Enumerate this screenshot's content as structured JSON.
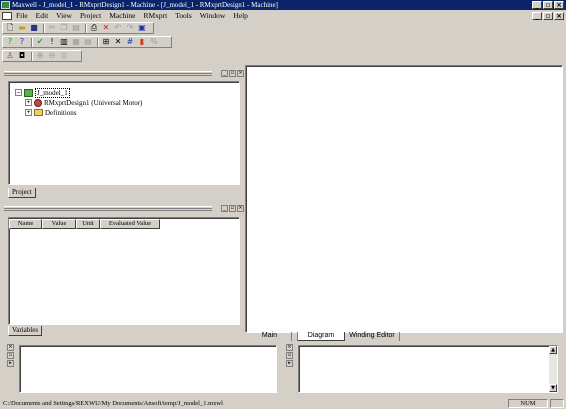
{
  "window": {
    "title": "Maxwell - J_model_1 - RMxprtDesign1 - Machine - [J_model_1 - RMxprtDesign1 - Machine]"
  },
  "menu": {
    "items": [
      "File",
      "Edit",
      "View",
      "Project",
      "Machine",
      "RMxprt",
      "Tools",
      "Window",
      "Help"
    ]
  },
  "toolbar1": {
    "icons": [
      "new-icon",
      "open-icon",
      "save-icon",
      "cut-icon",
      "copy-icon",
      "paste-icon",
      "print-icon",
      "delete-icon",
      "undo-icon",
      "redo-icon",
      "help-icon"
    ]
  },
  "toolbar2": {
    "icons": [
      "whats-this-icon",
      "context-help-icon",
      "validate-icon",
      "analyze-icon",
      "results-icon",
      "report-icon",
      "sweep-icon",
      "optimize-icon",
      "chart-icon",
      "export-icon"
    ]
  },
  "toolbar3": {
    "icons": [
      "motor-icon",
      "setup-icon",
      "zoom-in-icon",
      "zoom-out-icon",
      "zoom-fit-icon"
    ]
  },
  "project_tree": {
    "root": "J_model_1",
    "children": [
      {
        "label": "RMxprtDesign1  (Universal Motor)",
        "icon": "motor-icon"
      },
      {
        "label": "Definitions",
        "icon": "folder-icon"
      }
    ]
  },
  "project_tab": "Project",
  "variables": {
    "columns": [
      "Name",
      "Value",
      "Unit",
      "Evaluated Value"
    ],
    "tab": "Variables"
  },
  "doc_tabs": [
    "Main",
    "Diagram",
    "Winding Editor"
  ],
  "status": {
    "path": "C:/Documents and Settings/REXWU/My Documents/Ansoft/temp/J_model_1.mxwl",
    "indicator": "NUM"
  },
  "colors": {
    "title_bar": "#0a246a",
    "face": "#d4d0c8",
    "workspace": "#ffffff"
  }
}
